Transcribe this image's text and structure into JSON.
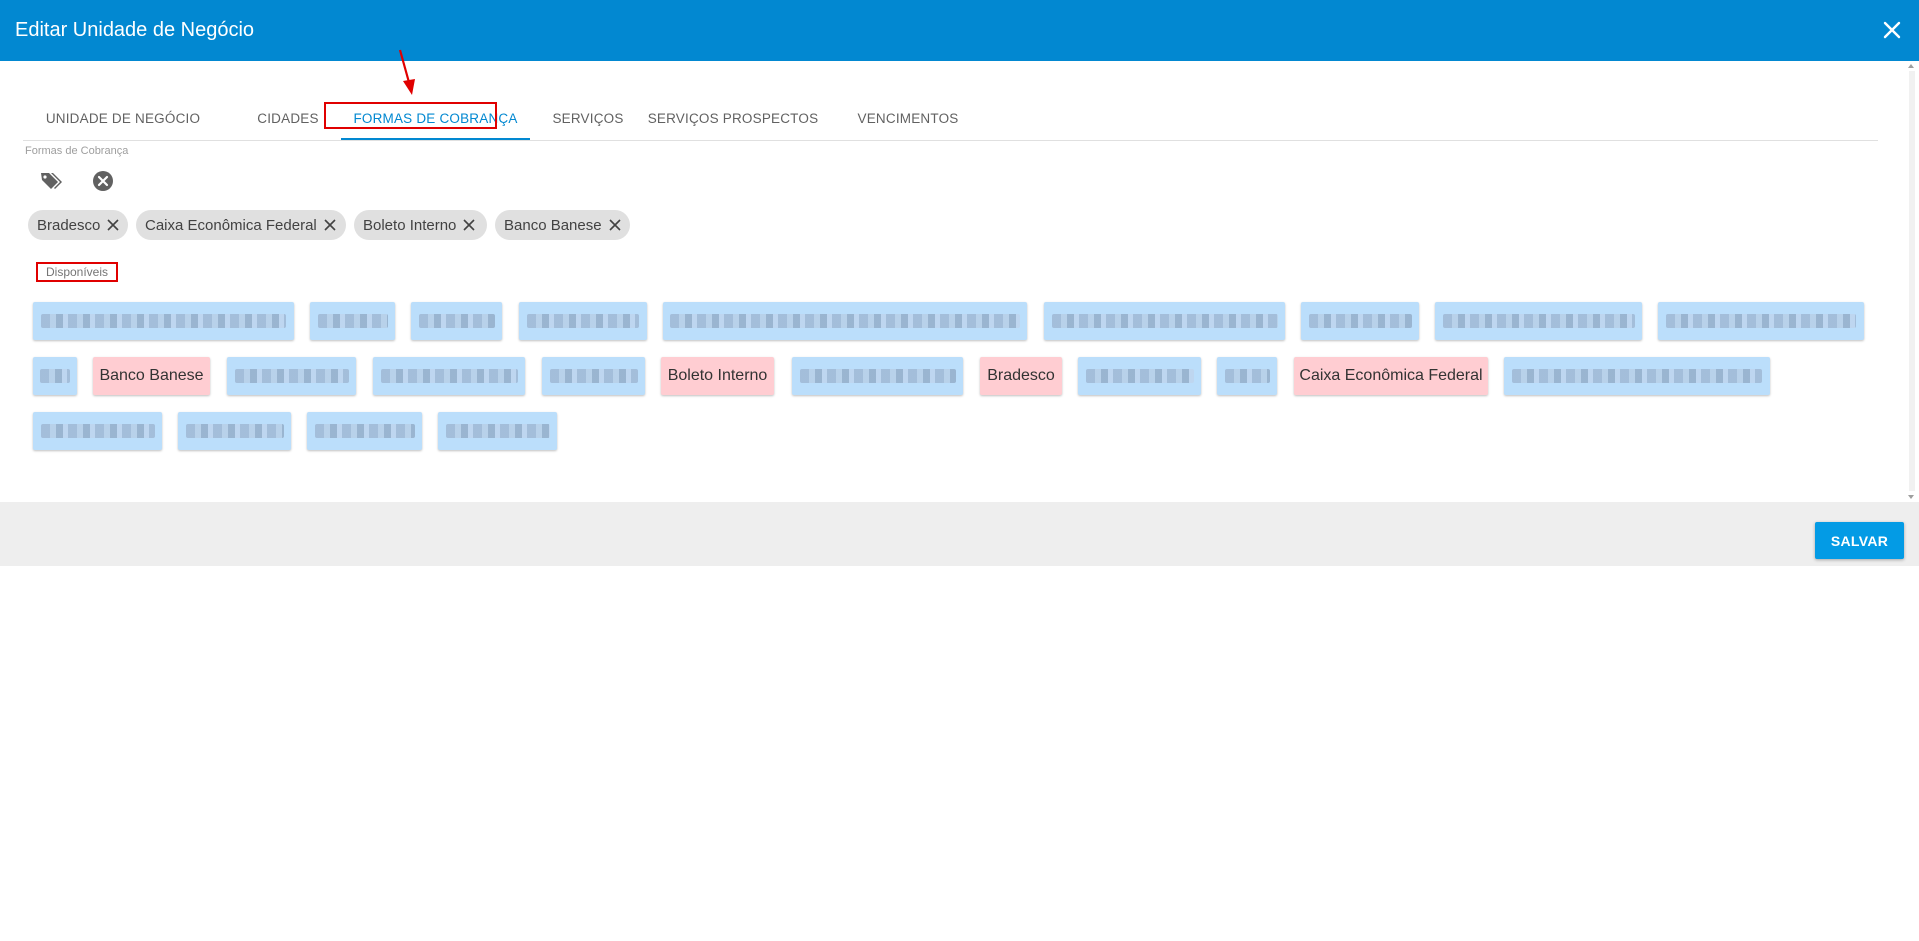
{
  "header": {
    "title": "Editar Unidade de Negócio"
  },
  "tabs": [
    {
      "label": "UNIDADE DE NEGÓCIO"
    },
    {
      "label": "CIDADES"
    },
    {
      "label": "FORMAS DE COBRANÇA"
    },
    {
      "label": "SERVIÇOS"
    },
    {
      "label": "SERVIÇOS PROSPECTOS"
    },
    {
      "label": "VENCIMENTOS"
    }
  ],
  "active_tab": "FORMAS DE COBRANÇA",
  "field": {
    "label": "Formas de Cobrança"
  },
  "selected_chips": [
    {
      "label": "Bradesco"
    },
    {
      "label": "Caixa Econômica Federal"
    },
    {
      "label": "Boleto Interno"
    },
    {
      "label": "Banco Banese"
    }
  ],
  "available": {
    "label": "Disponíveis",
    "visible_tags": [
      {
        "label": "Banco Banese"
      },
      {
        "label": "Boleto Interno"
      },
      {
        "label": "Bradesco"
      },
      {
        "label": "Caixa Econômica Federal"
      }
    ]
  },
  "footer": {
    "save_label": "SALVAR"
  },
  "colors": {
    "header": "#0288d1",
    "accent": "#0288d1",
    "tag_available": "#bbdefb",
    "tag_selected": "#ffcdd2",
    "highlight": "#e00000",
    "button": "#039be5"
  },
  "icons": [
    "close-icon",
    "tags-icon",
    "clear-circle-icon",
    "chip-remove-icon"
  ]
}
